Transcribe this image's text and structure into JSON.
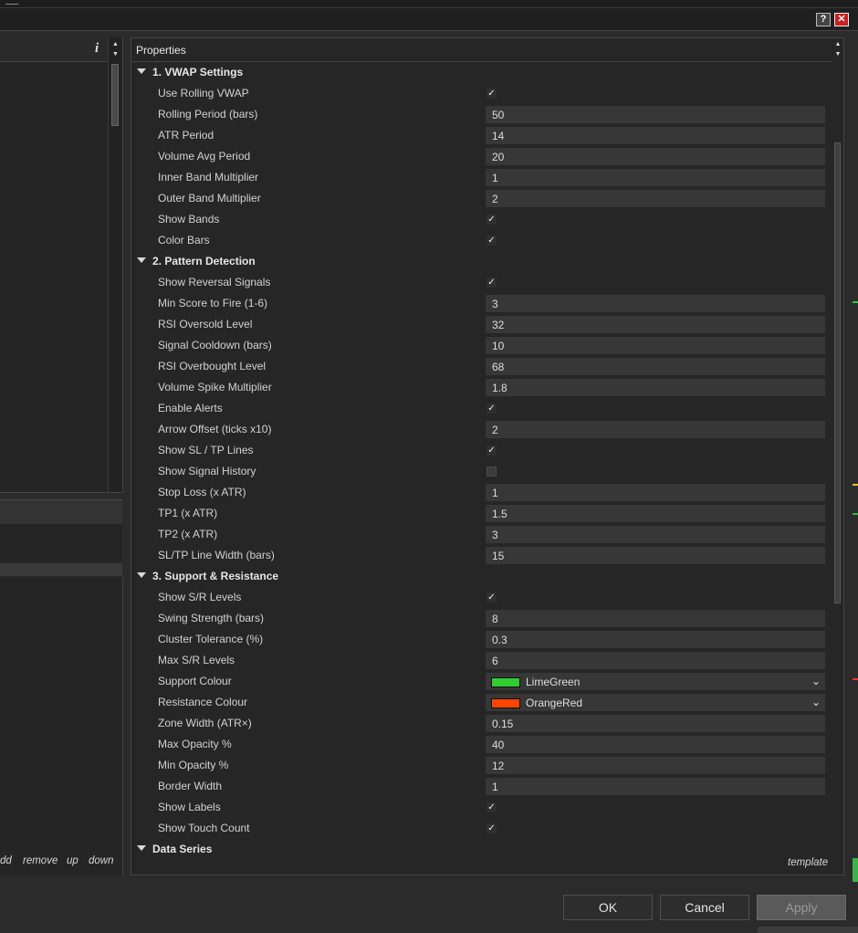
{
  "window": {
    "help_glyph": "?",
    "close_glyph": "✕"
  },
  "left_panel": {
    "info_glyph": "i",
    "links": [
      {
        "id": "add",
        "label": "dd"
      },
      {
        "id": "remove",
        "label": "remove"
      },
      {
        "id": "up",
        "label": "up"
      },
      {
        "id": "down",
        "label": "down"
      }
    ]
  },
  "properties": {
    "title": "Properties",
    "template_label": "template",
    "groups": [
      {
        "title": "1. VWAP Settings",
        "rows": [
          {
            "label": "Use Rolling VWAP",
            "type": "check",
            "checked": true
          },
          {
            "label": "Rolling Period (bars)",
            "type": "text",
            "value": "50"
          },
          {
            "label": "ATR Period",
            "type": "text",
            "value": "14"
          },
          {
            "label": "Volume Avg Period",
            "type": "text",
            "value": "20"
          },
          {
            "label": "Inner Band Multiplier",
            "type": "text",
            "value": "1"
          },
          {
            "label": "Outer Band Multiplier",
            "type": "text",
            "value": "2"
          },
          {
            "label": "Show Bands",
            "type": "check",
            "checked": true
          },
          {
            "label": "Color Bars",
            "type": "check",
            "checked": true
          }
        ]
      },
      {
        "title": "2. Pattern Detection",
        "rows": [
          {
            "label": "Show Reversal Signals",
            "type": "check",
            "checked": true
          },
          {
            "label": "Min Score to Fire (1-6)",
            "type": "text",
            "value": "3"
          },
          {
            "label": "RSI Oversold Level",
            "type": "text",
            "value": "32"
          },
          {
            "label": "Signal Cooldown (bars)",
            "type": "text",
            "value": "10"
          },
          {
            "label": "RSI Overbought Level",
            "type": "text",
            "value": "68"
          },
          {
            "label": "Volume Spike Multiplier",
            "type": "text",
            "value": "1.8"
          },
          {
            "label": "Enable Alerts",
            "type": "check",
            "checked": true
          },
          {
            "label": "Arrow Offset (ticks x10)",
            "type": "text",
            "value": "2"
          },
          {
            "label": "Show SL / TP Lines",
            "type": "check",
            "checked": true
          },
          {
            "label": "Show Signal History",
            "type": "check",
            "checked": false
          },
          {
            "label": "Stop Loss (x ATR)",
            "type": "text",
            "value": "1"
          },
          {
            "label": "TP1 (x ATR)",
            "type": "text",
            "value": "1.5"
          },
          {
            "label": "TP2 (x ATR)",
            "type": "text",
            "value": "3"
          },
          {
            "label": "SL/TP Line Width (bars)",
            "type": "text",
            "value": "15"
          }
        ]
      },
      {
        "title": "3. Support & Resistance",
        "rows": [
          {
            "label": "Show S/R Levels",
            "type": "check",
            "checked": true
          },
          {
            "label": "Swing Strength (bars)",
            "type": "text",
            "value": "8"
          },
          {
            "label": "Cluster Tolerance (%)",
            "type": "text",
            "value": "0.3"
          },
          {
            "label": "Max S/R Levels",
            "type": "text",
            "value": "6"
          },
          {
            "label": "Support Colour",
            "type": "color",
            "value": "LimeGreen",
            "color": "#32cd32"
          },
          {
            "label": "Resistance Colour",
            "type": "color",
            "value": "OrangeRed",
            "color": "#ff4500"
          },
          {
            "label": "Zone Width (ATR×)",
            "type": "text",
            "value": "0.15"
          },
          {
            "label": "Max Opacity %",
            "type": "text",
            "value": "40"
          },
          {
            "label": "Min Opacity %",
            "type": "text",
            "value": "12"
          },
          {
            "label": "Border Width",
            "type": "text",
            "value": "1"
          },
          {
            "label": "Show Labels",
            "type": "check",
            "checked": true
          },
          {
            "label": "Show Touch Count",
            "type": "check",
            "checked": true
          }
        ]
      },
      {
        "title": "Data Series",
        "rows": []
      }
    ]
  },
  "buttons": {
    "ok": "OK",
    "cancel": "Cancel",
    "apply": "Apply"
  },
  "chart_edge_colors": [
    "#2ecc40",
    "#ff3333",
    "#e8c02a",
    "#3ab54a"
  ]
}
